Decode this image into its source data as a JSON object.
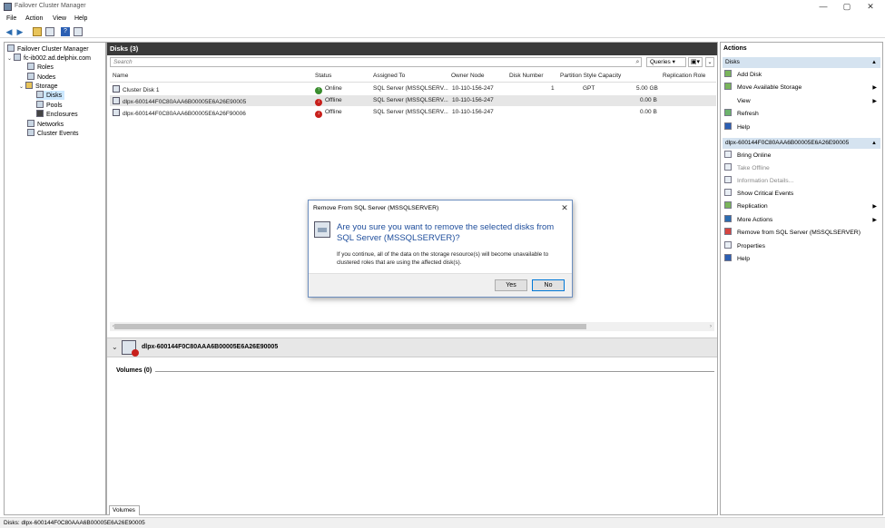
{
  "window": {
    "title": "Failover Cluster Manager",
    "controls": [
      "—",
      "▢",
      "✕"
    ]
  },
  "menu": [
    "File",
    "Action",
    "View",
    "Help"
  ],
  "tree": {
    "root": "Failover Cluster Manager",
    "cluster": "fc-ib002.ad.delphix.com",
    "roles": "Roles",
    "nodes": "Nodes",
    "storage": "Storage",
    "disks": "Disks",
    "pools": "Pools",
    "enclosures": "Enclosures",
    "networks": "Networks",
    "cluster_events": "Cluster Events"
  },
  "center": {
    "header": "Disks (3)",
    "search_placeholder": "Search",
    "queries_label": "Queries",
    "columns": [
      "Name",
      "Status",
      "Assigned To",
      "Owner Node",
      "Disk Number",
      "Partition Style",
      "Capacity",
      "Replication Role"
    ],
    "rows": [
      {
        "name": "Cluster Disk 1",
        "status": "Online",
        "assigned": "SQL Server (MSSQLSERV...",
        "owner": "10-110-156-247",
        "disk_number": "1",
        "partition": "GPT",
        "capacity": "5.00 GB",
        "replication": ""
      },
      {
        "name": "dlpx-600144F0C80AAA6B00005E6A26E90005",
        "status": "Offline",
        "assigned": "SQL Server (MSSQLSERV...",
        "owner": "10-110-156-247",
        "disk_number": "",
        "partition": "",
        "capacity": "0.00 B",
        "replication": ""
      },
      {
        "name": "dlpx-600144F0C80AAA6B00005E6A26F90006",
        "status": "Offline",
        "assigned": "SQL Server (MSSQLSERV...",
        "owner": "10-110-156-247",
        "disk_number": "",
        "partition": "",
        "capacity": "0.00 B",
        "replication": ""
      }
    ],
    "detail_title": "dlpx-600144F0C80AAA6B00005E6A26E90005",
    "volumes_label": "Volumes (0)",
    "volumes_tab": "Volumes"
  },
  "actions": {
    "header": "Actions",
    "section1": "Disks",
    "items1": [
      "Add Disk",
      "Move Available Storage",
      "View",
      "Refresh",
      "Help"
    ],
    "section2": "dlpx-600144F0C80AAA6B00005E6A26E90005",
    "items2": [
      "Bring Online",
      "Take Offline",
      "Information Details...",
      "Show Critical Events",
      "Replication",
      "More Actions",
      "Remove from SQL Server (MSSQLSERVER)",
      "Properties",
      "Help"
    ]
  },
  "dialog": {
    "title": "Remove From SQL Server (MSSQLSERVER)",
    "close": "✕",
    "question": "Are you sure you want to remove the selected disks from SQL Server (MSSQLSERVER)?",
    "body": "If you continue, all of the data on the storage resource(s) will become unavailable to clustered roles that are using the affected disk(s).",
    "yes": "Yes",
    "no": "No"
  },
  "statusbar": "Disks: dlpx-600144F0C80AAA6B00005E6A26E90005",
  "colors": {
    "dialog_question": "#1f4e9c",
    "online": "#3a8d2e",
    "offline": "#c8201c",
    "section_bg": "#d5e3f0"
  }
}
